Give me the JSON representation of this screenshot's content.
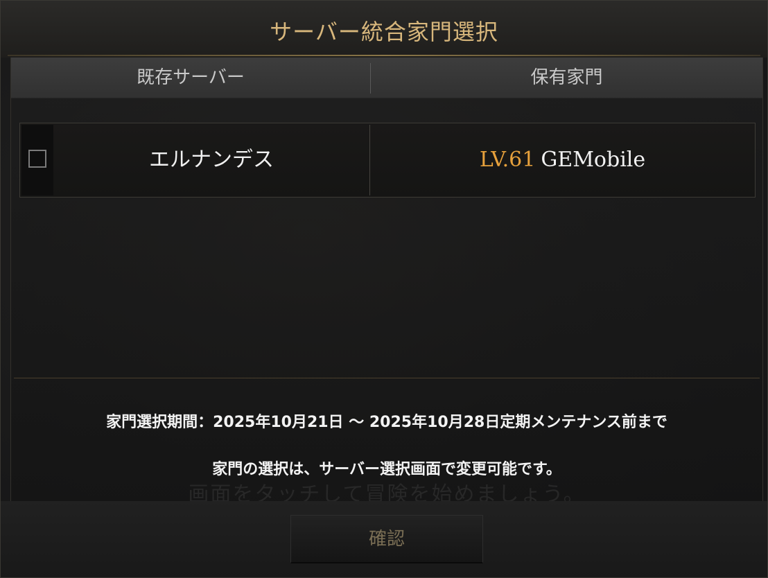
{
  "dialog": {
    "title": "サーバー統合家門選択"
  },
  "table": {
    "headers": {
      "server": "既存サーバー",
      "family": "保有家門"
    },
    "rows": [
      {
        "checked": false,
        "server": "エルナンデス",
        "level": "LV.61",
        "family_name": "GEMobile"
      }
    ]
  },
  "notices": {
    "period": "家門選択期間：2025年10月21日 〜 2025年10月28日定期メンテナンス前まで",
    "change": "家門の選択は、サーバー選択画面で変更可能です。"
  },
  "background_text": "画面をタッチして冒険を始めましょう。",
  "footer": {
    "confirm_label": "確認"
  },
  "colors": {
    "title": "#d8b77c",
    "level": "#e7a13c",
    "confirm_text": "#7b6f55"
  }
}
